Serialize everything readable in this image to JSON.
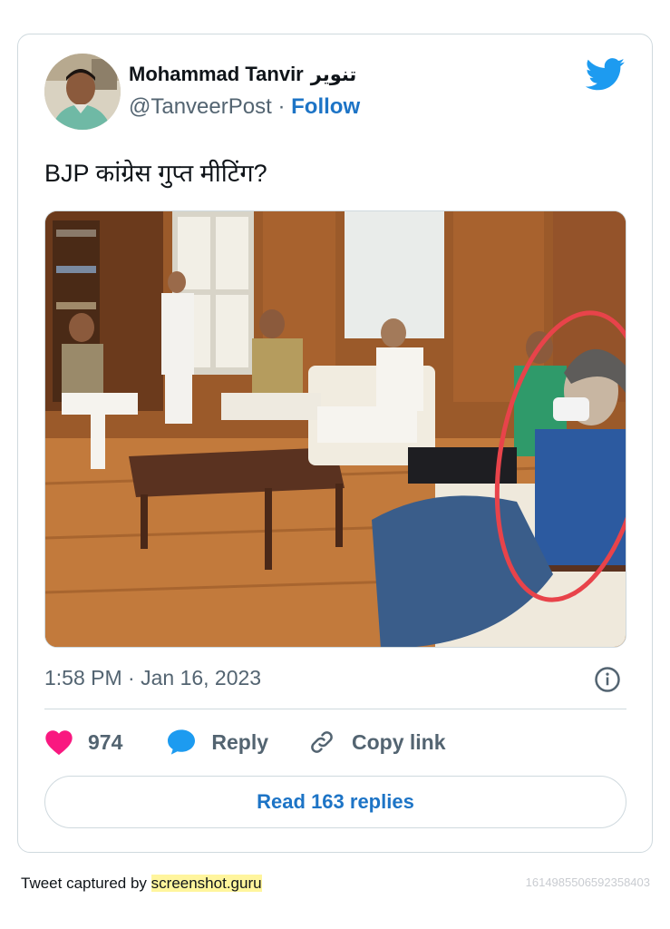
{
  "tweet": {
    "author_name": "Mohammad Tanvir",
    "author_name_urdu": "تنویر",
    "handle": "@TanveerPost",
    "separator": "·",
    "follow_label": "Follow",
    "text": "BJP कांग्रेस गुप्त मीटिंग?",
    "timestamp": "1:58 PM · Jan 16, 2023",
    "like_count": "974",
    "reply_label": "Reply",
    "copy_link_label": "Copy link",
    "read_replies_label": "Read 163 replies"
  },
  "footer": {
    "captured_by": "Tweet captured by",
    "brand": "screenshot.guru",
    "tweet_id": "1614985506592358403"
  },
  "colors": {
    "accent": "#1d74c6",
    "like": "#f91880",
    "twitter_blue": "#1d9bf0",
    "annotation_red": "#e8434a"
  }
}
